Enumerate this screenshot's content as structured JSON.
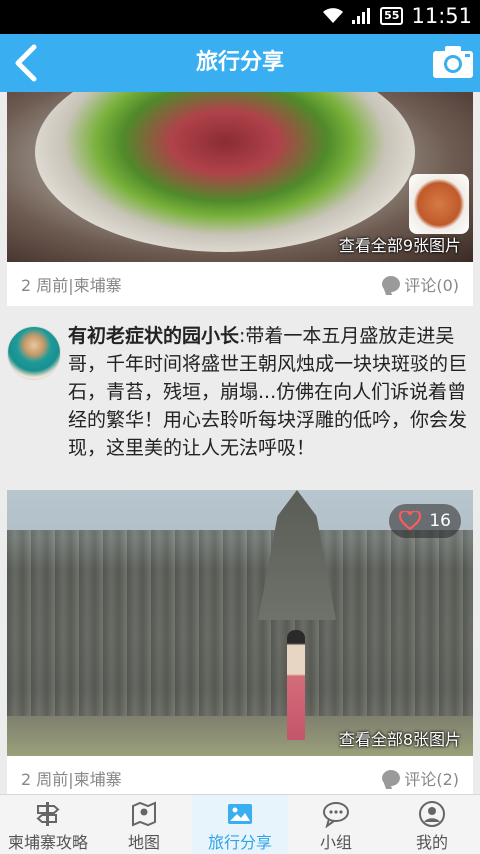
{
  "status": {
    "time": "11:51",
    "battery": "55"
  },
  "header": {
    "title": "旅行分享"
  },
  "posts": [
    {
      "view_all": "查看全部9张图片",
      "meta": "2 周前|柬埔寨",
      "comments": "评论(0)"
    },
    {
      "author": "有初老症状的园小长",
      "text": ":带着一本五月盛放走进吴哥，千年时间将盛世王朝风烛成一块块斑驳的巨石，青苔，残垣，崩塌...仿佛在向人们诉说着曾经的繁华！用心去聆听每块浮雕的低吟，你会发现，这里美的让人无法呼吸！",
      "likes": "16",
      "view_all": "查看全部8张图片",
      "meta": "2 周前|柬埔寨",
      "comments": "评论(2)"
    }
  ],
  "nav": [
    {
      "label": "柬埔寨攻略",
      "icon": "signpost-icon"
    },
    {
      "label": "地图",
      "icon": "map-icon"
    },
    {
      "label": "旅行分享",
      "icon": "photo-icon"
    },
    {
      "label": "小组",
      "icon": "chat-icon"
    },
    {
      "label": "我的",
      "icon": "profile-icon"
    }
  ],
  "colors": {
    "accent": "#39aef0",
    "active_label": "#2fa3e8"
  }
}
